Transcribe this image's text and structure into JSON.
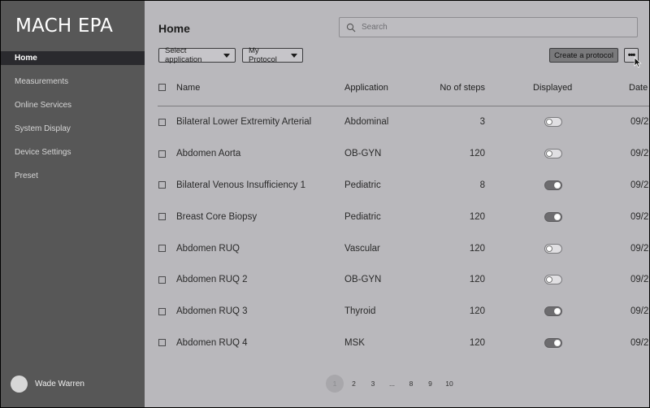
{
  "app": {
    "title": "MACH EPA"
  },
  "sidebar": {
    "items": [
      {
        "label": "Home",
        "active": true
      },
      {
        "label": "Measurements",
        "active": false
      },
      {
        "label": "Online Services",
        "active": false
      },
      {
        "label": "System Display",
        "active": false
      },
      {
        "label": "Device Settings",
        "active": false
      },
      {
        "label": "Preset",
        "active": false
      }
    ],
    "user": {
      "name": "Wade Warren"
    }
  },
  "header": {
    "title": "Home",
    "search_placeholder": "Search"
  },
  "toolbar": {
    "select_application": "Select application",
    "my_protocol": "My Protocol",
    "create_protocol": "Create a protocol",
    "more": "•••"
  },
  "table": {
    "columns": {
      "name": "Name",
      "application": "Application",
      "steps": "No of steps",
      "displayed": "Displayed",
      "date": "Date"
    },
    "rows": [
      {
        "name": "Bilateral Lower Extremity Arterial",
        "application": "Abdominal",
        "steps": "3",
        "displayed": false,
        "date": "09/2"
      },
      {
        "name": "Abdomen Aorta",
        "application": "OB-GYN",
        "steps": "120",
        "displayed": false,
        "date": "09/2"
      },
      {
        "name": "Bilateral Venous Insufficiency 1",
        "application": "Pediatric",
        "steps": "8",
        "displayed": true,
        "date": "09/2"
      },
      {
        "name": "Breast Core Biopsy",
        "application": "Pediatric",
        "steps": "120",
        "displayed": true,
        "date": "09/2"
      },
      {
        "name": "Abdomen RUQ",
        "application": "Vascular",
        "steps": "120",
        "displayed": false,
        "date": "09/2"
      },
      {
        "name": "Abdomen RUQ 2",
        "application": "OB-GYN",
        "steps": "120",
        "displayed": false,
        "date": "09/2"
      },
      {
        "name": "Abdomen RUQ 3",
        "application": "Thyroid",
        "steps": "120",
        "displayed": true,
        "date": "09/2"
      },
      {
        "name": "Abdomen RUQ 4",
        "application": "MSK",
        "steps": "120",
        "displayed": true,
        "date": "09/2"
      }
    ]
  },
  "pagination": {
    "pages": [
      "1",
      "2",
      "3",
      "...",
      "8",
      "9",
      "10"
    ],
    "current": "1"
  },
  "icons": {
    "search": "search-icon",
    "caret": "caret-down-icon",
    "cursor": "mouse-cursor-icon"
  }
}
